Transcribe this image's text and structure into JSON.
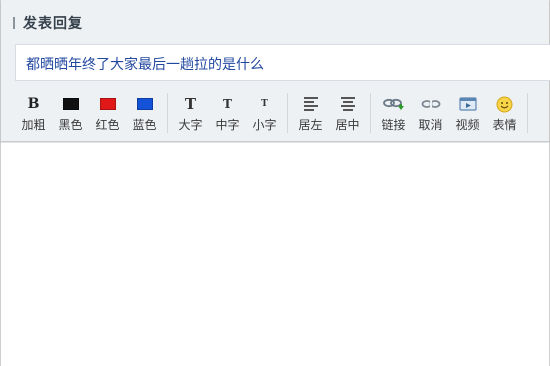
{
  "header": {
    "title": "发表回复"
  },
  "subject": {
    "value": "都晒晒年终了大家最后一趟拉的是什么"
  },
  "toolbar": {
    "colors": {
      "black": "#111111",
      "red": "#e01818",
      "blue": "#1452d8"
    },
    "buttons": {
      "bold": "加粗",
      "black": "黑色",
      "red": "红色",
      "blue": "蓝色",
      "big": "大字",
      "medium": "中字",
      "small": "小字",
      "left": "居左",
      "center": "居中",
      "link": "链接",
      "unlink": "取消",
      "video": "视频",
      "emoji": "表情"
    },
    "icons": {
      "bold_glyph": "B",
      "size_glyph": "T"
    }
  },
  "editor": {
    "content": ""
  }
}
